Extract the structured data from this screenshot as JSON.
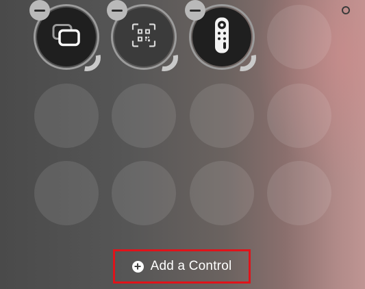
{
  "controls": [
    {
      "name": "screen-mirroring",
      "icon": "screen-mirroring-icon"
    },
    {
      "name": "code-scanner",
      "icon": "qr-code-scanner-icon"
    },
    {
      "name": "apple-tv-remote",
      "icon": "tv-remote-icon"
    }
  ],
  "empty_slots": 9,
  "add_control": {
    "label": "Add a Control",
    "icon": "plus-circle-icon"
  },
  "colors": {
    "highlight_border": "#e0131a",
    "remove_badge": "#b9b9b9"
  }
}
